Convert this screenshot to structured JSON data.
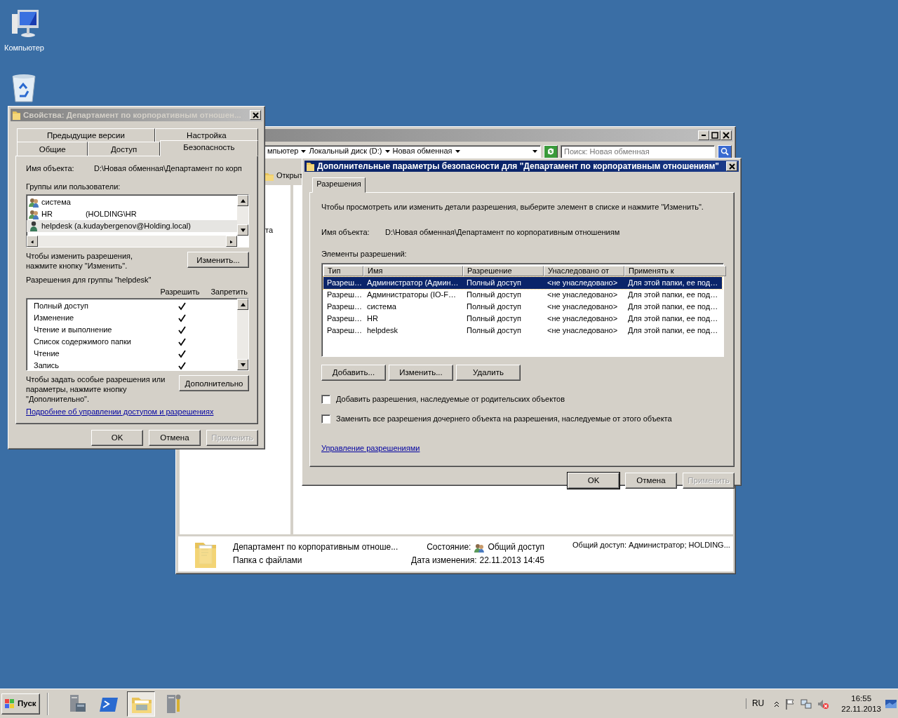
{
  "desktop_icons": [
    {
      "kind": "computer",
      "label": "Компьютер"
    },
    {
      "kind": "recycle"
    }
  ],
  "explorer": {
    "breadcrumb": [
      "мпьютер",
      "Локальный диск (D:)",
      "Новая обменная"
    ],
    "search": {
      "placeholder": "Поиск: Новая обменная"
    },
    "toolbar": [
      "Открыт"
    ],
    "nav_items": [
      "та"
    ],
    "details": {
      "name": "Департамент по корпоративным отноше...",
      "type": "Папка с файлами",
      "state_label": "Состояние:",
      "state": "Общий доступ",
      "modified_label": "Дата изменения:",
      "modified": "22.11.2013 14:45",
      "sharing": "Общий доступ: Администратор; HOLDING..."
    }
  },
  "properties": {
    "title": "Свойства: Департамент по корпоративным отношен...",
    "tabs_back": [
      {
        "label": "Предыдущие версии",
        "selected": false
      },
      {
        "label": "Настройка",
        "selected": false
      }
    ],
    "tabs_front": [
      {
        "label": "Общие",
        "selected": false
      },
      {
        "label": "Доступ",
        "selected": false
      },
      {
        "label": "Безопасность",
        "selected": true
      }
    ],
    "object_label": "Имя объекта:",
    "object_name": "D:\\Новая обменная\\Департамент по корп",
    "groups_label": "Группы или пользователи:",
    "groups": [
      {
        "kind": "group",
        "name": "система",
        "selected": false
      },
      {
        "kind": "group",
        "name": "HR",
        "detail": "(HOLDING\\HR",
        "selected": false
      },
      {
        "kind": "user",
        "name": "helpdesk (a.kudaybergenov@Holding.local)",
        "selected": true
      }
    ],
    "change_hint": "Чтобы изменить разрешения, нажмите кнопку \"Изменить\".",
    "change_button": "Изменить...",
    "perms_label": "Разрешения для группы \"helpdesk\"",
    "allow_header": "Разрешить",
    "deny_header": "Запретить",
    "permissions": [
      {
        "name": "Полный доступ",
        "allow": true,
        "deny": false
      },
      {
        "name": "Изменение",
        "allow": true,
        "deny": false
      },
      {
        "name": "Чтение и выполнение",
        "allow": true,
        "deny": false
      },
      {
        "name": "Список содержимого папки",
        "allow": true,
        "deny": false
      },
      {
        "name": "Чтение",
        "allow": true,
        "deny": false
      },
      {
        "name": "Запись",
        "allow": true,
        "deny": false
      }
    ],
    "advanced_hint": "Чтобы задать особые разрешения или параметры, нажмите кнопку \"Дополнительно\".",
    "advanced_button": "Дополнительно",
    "link": "Подробнее об управлении доступом и разрешениях",
    "buttons": [
      {
        "label": "OK",
        "disabled": false
      },
      {
        "label": "Отмена",
        "disabled": false
      },
      {
        "label": "Применить",
        "disabled": true
      }
    ]
  },
  "advanced": {
    "title": "Дополнительные параметры безопасности  для \"Департамент по корпоративным отношениям\"",
    "tabs": [
      {
        "label": "Разрешения",
        "selected": true
      }
    ],
    "intro": "Чтобы просмотреть или изменить детали разрешения, выберите элемент в списке и нажмите \"Изменить\".",
    "object_label": "Имя объекта:",
    "object_name": "D:\\Новая обменная\\Департамент по корпоративным отношениям",
    "entries_label": "Элементы разрешений:",
    "columns": [
      "Тип",
      "Имя",
      "Разрешение",
      "Унаследовано от",
      "Применять к"
    ],
    "rows": [
      {
        "cells": [
          "Разреш…",
          "Администратор (Админ…",
          "Полный доступ",
          "<не унаследовано>",
          "Для этой папки, ее под…"
        ],
        "selected": true
      },
      {
        "cells": [
          "Разреш…",
          "Администраторы (IO-F…",
          "Полный доступ",
          "<не унаследовано>",
          "Для этой папки, ее под…"
        ],
        "selected": false
      },
      {
        "cells": [
          "Разреш…",
          "система",
          "Полный доступ",
          "<не унаследовано>",
          "Для этой папки, ее под…"
        ],
        "selected": false
      },
      {
        "cells": [
          "Разреш…",
          "HR",
          "Полный доступ",
          "<не унаследовано>",
          "Для этой папки, ее под…"
        ],
        "selected": false
      },
      {
        "cells": [
          "Разреш…",
          "helpdesk",
          "Полный доступ",
          "<не унаследовано>",
          "Для этой папки, ее под…"
        ],
        "selected": false
      }
    ],
    "actions": [
      "Добавить...",
      "Изменить...",
      "Удалить"
    ],
    "checkboxes": [
      {
        "label": "Добавить разрешения, наследуемые от родительских объектов",
        "checked": false
      },
      {
        "label": "Заменить все разрешения дочернего объекта на разрешения, наследуемые от этого объекта",
        "checked": false
      }
    ],
    "link": "Управление разрешениями",
    "buttons": [
      {
        "label": "OK",
        "disabled": false,
        "default": true
      },
      {
        "label": "Отмена",
        "disabled": false,
        "default": false
      },
      {
        "label": "Применить",
        "disabled": true,
        "default": false
      }
    ]
  },
  "taskbar": {
    "start": "Пуск",
    "apps": [
      {
        "kind": "server",
        "active": false
      },
      {
        "kind": "shell",
        "active": false
      },
      {
        "kind": "folder",
        "active": true
      },
      {
        "kind": "tools",
        "active": false
      }
    ],
    "language": "RU",
    "time": "16:55",
    "date": "22.11.2013"
  }
}
